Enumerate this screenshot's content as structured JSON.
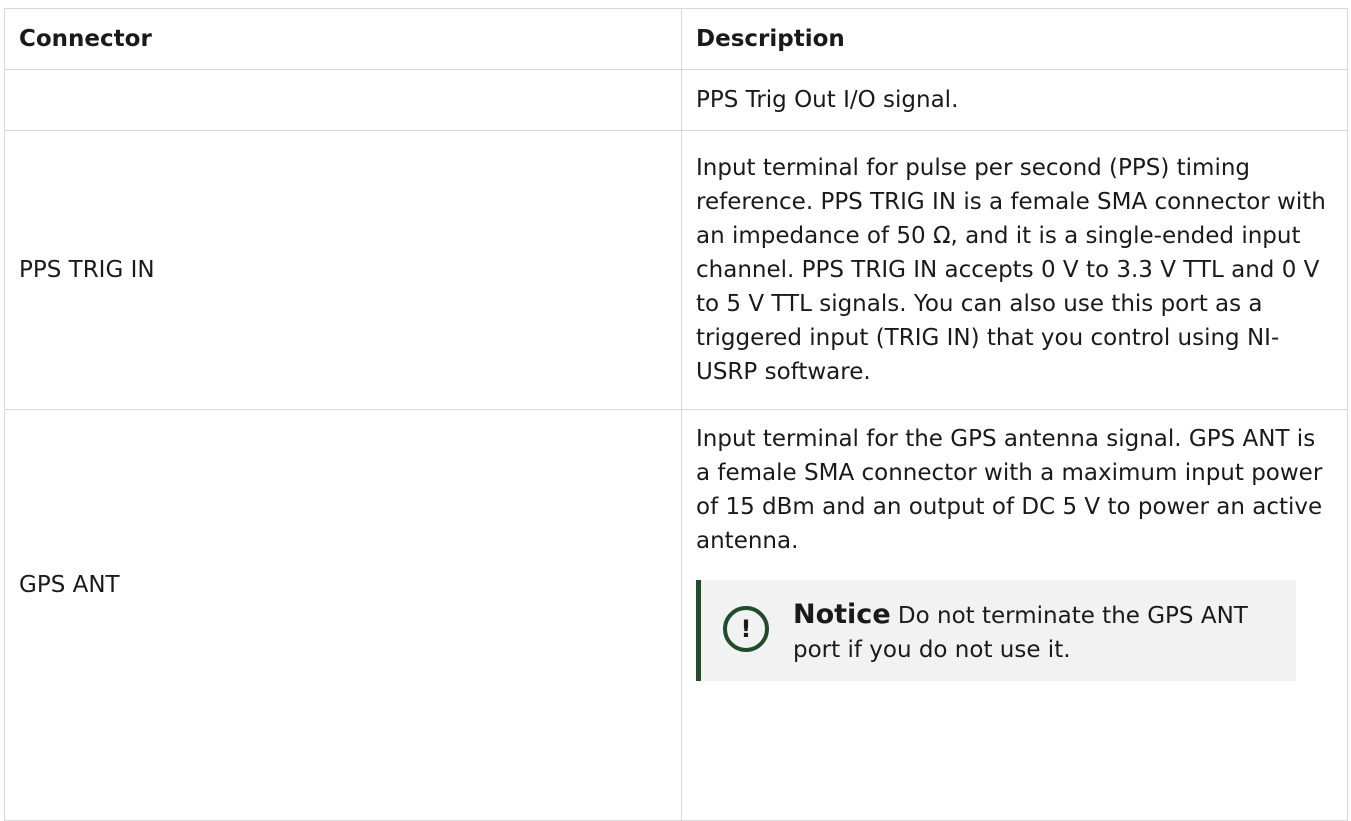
{
  "table": {
    "headers": {
      "connector": "Connector",
      "description": "Description"
    },
    "rows": [
      {
        "connector": "",
        "description": "PPS Trig Out I/O signal."
      },
      {
        "connector": "PPS TRIG IN",
        "description": "Input terminal for pulse per second (PPS) timing reference. PPS TRIG IN is a female SMA connector with an impedance of 50 Ω, and it is a single-ended input channel. PPS TRIG IN accepts 0 V to 3.3 V TTL and 0 V to 5 V TTL signals. You can also use this port as a triggered input (TRIG IN) that you control using NI-USRP software."
      },
      {
        "connector": "GPS ANT",
        "description": "Input terminal for the GPS antenna signal. GPS ANT is a female SMA connector with a maximum input power of 15 dBm and an output of DC 5 V to power an active antenna.",
        "notice": {
          "icon": "exclamation-icon",
          "label": "Notice",
          "text": " Do not terminate the GPS ANT port if you do not use it."
        }
      }
    ]
  },
  "colors": {
    "border": "#d6d6d6",
    "notice_accent": "#1f4d2b",
    "notice_background": "#f2f2f2"
  }
}
